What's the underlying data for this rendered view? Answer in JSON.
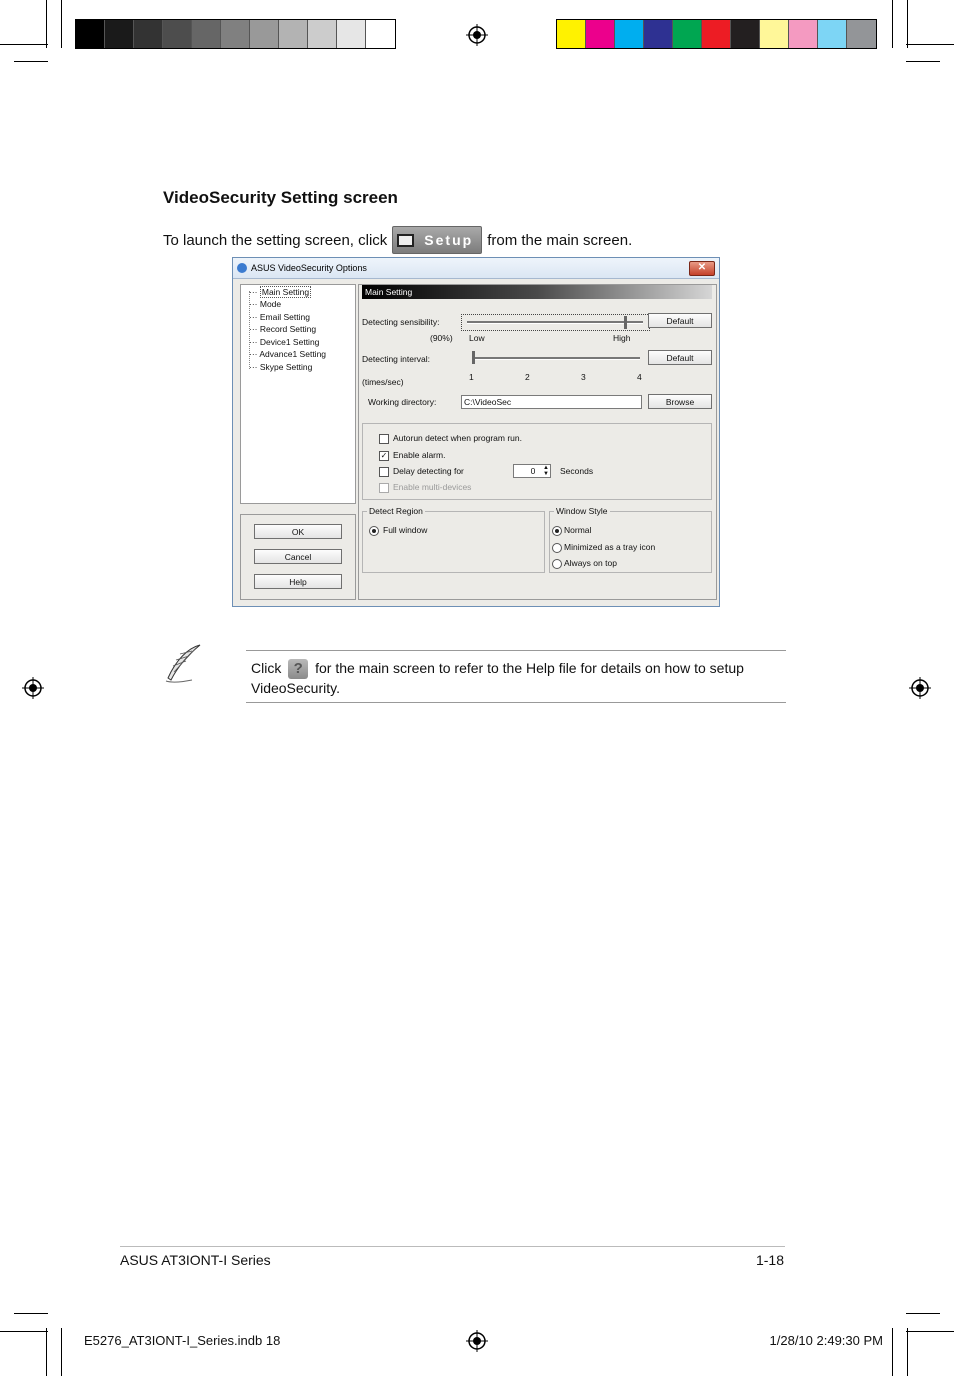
{
  "heading": "VideoSecurity Setting screen",
  "intro": {
    "before": "To launch the setting screen, click",
    "button_label": "Setup",
    "after": "from the main screen."
  },
  "dialog": {
    "title": "ASUS VideoSecurity Options",
    "close_glyph": "✕",
    "tree": [
      "Main Setting",
      "Mode",
      "Email Setting",
      "Record Setting",
      "Device1 Setting",
      "Advance1 Setting",
      "Skype Setting"
    ],
    "buttons": {
      "ok": "OK",
      "cancel": "Cancel",
      "help": "Help"
    },
    "panel_title": "Main Setting",
    "sensibility": {
      "label": "Detecting sensibility:",
      "value": "(90%)",
      "low": "Low",
      "high": "High",
      "default": "Default",
      "level": 0.9
    },
    "interval": {
      "label": "Detecting interval:",
      "unit": "(times/sec)",
      "ticks": [
        "1",
        "2",
        "3",
        "4"
      ],
      "default": "Default",
      "value": 1
    },
    "workdir": {
      "label": "Working directory:",
      "value": "C:\\VideoSec",
      "browse": "Browse"
    },
    "options": {
      "autorun": {
        "label": "Autorun detect when program run.",
        "checked": false
      },
      "alarm": {
        "label": "Enable alarm.",
        "checked": true
      },
      "delay": {
        "label": "Delay detecting for",
        "value": "0",
        "unit": "Seconds",
        "checked": false
      },
      "multi": {
        "label": "Enable multi-devices",
        "checked": false
      }
    },
    "detect_region": {
      "legend": "Detect Region",
      "options": [
        "Full window"
      ]
    },
    "window_style": {
      "legend": "Window Style",
      "options": [
        "Normal",
        "Minimized as a tray icon",
        "Always on top"
      ]
    }
  },
  "note": {
    "before": "Click",
    "icon_glyph": "?",
    "after": "for the main screen to refer to the Help file for details on how to setup VideoSecurity."
  },
  "footer": {
    "left": "ASUS AT3IONT-I Series",
    "right": "1-18"
  },
  "slug": {
    "file": "E5276_AT3IONT-I_Series.indb   18",
    "date": "1/28/10   2:49:30 PM"
  },
  "colors": {
    "gray_bar": [
      "#000000",
      "#1a1a1a",
      "#333333",
      "#4d4d4d",
      "#666666",
      "#808080",
      "#999999",
      "#b3b3b3",
      "#cccccc",
      "#e6e6e6",
      "#ffffff"
    ],
    "color_bar": [
      "#fff200",
      "#ec008c",
      "#00aeef",
      "#2e3192",
      "#00a651",
      "#ed1c24",
      "#231f20",
      "#fff799",
      "#f49ac1",
      "#7dd5f5",
      "#939598"
    ]
  }
}
